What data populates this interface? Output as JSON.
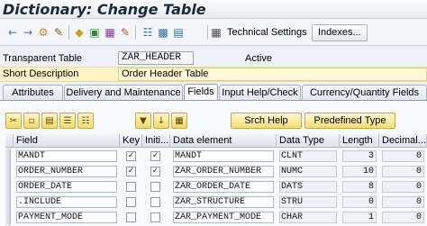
{
  "window": {
    "title": "Dictionary: Change Table"
  },
  "toolbar": {
    "icons": [
      "back-arrow-icon",
      "forward-arrow-icon",
      "other-object-icon",
      "display-change-icon",
      "check-icon",
      "activate-icon",
      "where-used-icon",
      "object-list-icon",
      "hierarchy-icon",
      "navigation-window-icon",
      "info-icon"
    ],
    "technical_settings_label": "Technical Settings",
    "indexes_label": "Indexes..."
  },
  "header": {
    "transparent_table_label": "Transparent Table",
    "transparent_table_value": "ZAR_HEADER",
    "status_value": "Active",
    "short_description_label": "Short Description",
    "short_description_value": "Order Header Table"
  },
  "tabs": [
    {
      "label": "Attributes",
      "active": false
    },
    {
      "label": "Delivery and Maintenance",
      "active": false
    },
    {
      "label": "Fields",
      "active": true
    },
    {
      "label": "Input Help/Check",
      "active": false
    },
    {
      "label": "Currency/Quantity Fields",
      "active": false
    }
  ],
  "table_toolbar": {
    "icons": [
      "cut-icon",
      "copy-icon",
      "paste-icon",
      "insert-row-icon",
      "delete-row-icon",
      "find-icon",
      "down-arrow-icon",
      "filter-icon"
    ],
    "srch_help_label": "Srch Help",
    "predefined_type_label": "Predefined Type"
  },
  "grid": {
    "columns": [
      "Field",
      "Key",
      "Initi...",
      "Data element",
      "Data Type",
      "Length",
      "Decimal..."
    ],
    "rows": [
      {
        "field": "MANDT",
        "key": true,
        "initial": true,
        "data_element": "MANDT",
        "data_type": "CLNT",
        "length": "3",
        "decimals": "0"
      },
      {
        "field": "ORDER_NUMBER",
        "key": true,
        "initial": true,
        "data_element": "ZAR_ORDER_NUMBER",
        "data_type": "NUMC",
        "length": "10",
        "decimals": "0"
      },
      {
        "field": "ORDER_DATE",
        "key": false,
        "initial": false,
        "data_element": "ZAR_ORDER_DATE",
        "data_type": "DATS",
        "length": "8",
        "decimals": "0"
      },
      {
        "field": ".INCLUDE",
        "key": false,
        "initial": false,
        "data_element": "ZAR_STRUCTURE",
        "data_type": "STRU",
        "length": "0",
        "decimals": "0"
      },
      {
        "field": "PAYMENT_MODE",
        "key": false,
        "initial": false,
        "data_element": "ZAR_PAYMENT_MODE",
        "data_type": "CHAR",
        "length": "1",
        "decimals": "0"
      }
    ]
  },
  "colors": {
    "short_description_highlight": "#fdf3c6",
    "button_yellow": "#f5dd72"
  }
}
